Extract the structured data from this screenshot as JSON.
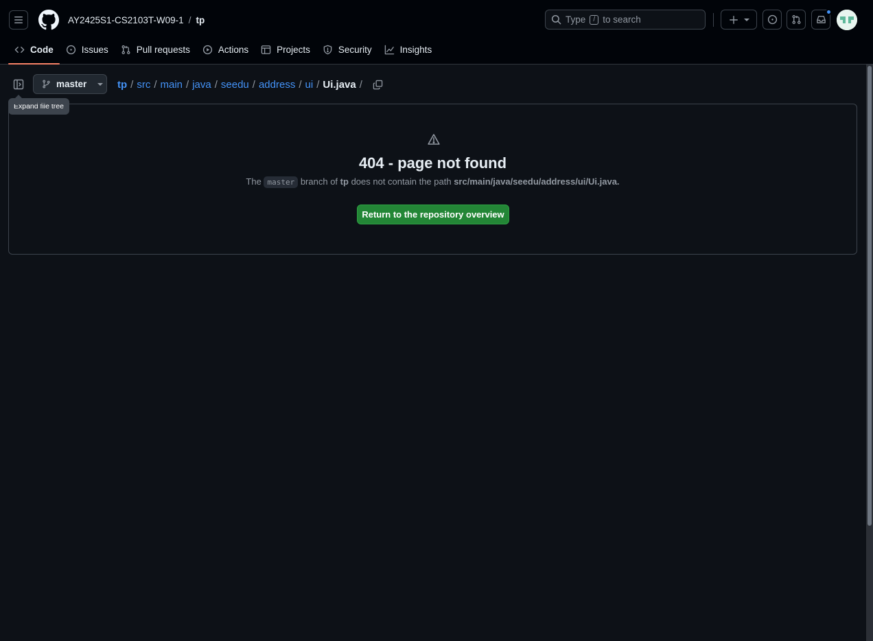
{
  "header": {
    "owner": "AY2425S1-CS2103T-W09-1",
    "separator": "/",
    "repo": "tp",
    "search_prefix": "Type",
    "search_key": "/",
    "search_suffix": "to search"
  },
  "tabs": [
    {
      "label": "Code",
      "icon": "code-icon",
      "selected": true
    },
    {
      "label": "Issues",
      "icon": "issue-icon"
    },
    {
      "label": "Pull requests",
      "icon": "pull-request-icon"
    },
    {
      "label": "Actions",
      "icon": "play-icon"
    },
    {
      "label": "Projects",
      "icon": "table-icon"
    },
    {
      "label": "Security",
      "icon": "shield-icon"
    },
    {
      "label": "Insights",
      "icon": "graph-icon"
    }
  ],
  "file_nav": {
    "branch": "master",
    "tooltip": "Expand file tree",
    "breadcrumb": [
      "tp",
      "src",
      "main",
      "java",
      "seedu",
      "address",
      "ui"
    ],
    "current_file": "Ui.java",
    "separator": "/"
  },
  "error": {
    "title": "404 - page not found",
    "msg_the": "The",
    "msg_branch": "master",
    "msg_branch_of": "branch of",
    "msg_repo": "tp",
    "msg_path_intro": "does not contain the path",
    "msg_path": "src/main/java/seedu/address/ui/Ui.java.",
    "button_label": "Return to the repository overview"
  },
  "colors": {
    "background": "#0d1117",
    "header": "#010409",
    "link": "#4493f8",
    "primary_button": "#238636",
    "tab_underline": "#f78166",
    "notification_dot": "#4493f8"
  }
}
